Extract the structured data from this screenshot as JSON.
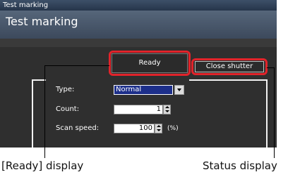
{
  "window": {
    "titlebar_text": "Test marking",
    "header_title": "Test marking"
  },
  "status": {
    "ready_label": "Ready",
    "status_label": "Close shutter"
  },
  "form": {
    "type_label": "Type:",
    "type_value": "Normal",
    "count_label": "Count:",
    "count_value": "1",
    "scan_speed_label": "Scan speed:",
    "scan_speed_value": "100",
    "scan_speed_unit": "(%)"
  },
  "captions": {
    "ready_caption": "[Ready] display",
    "status_caption": "Status display"
  },
  "colors": {
    "callout_red": "#e2232a",
    "select_blue": "#1d2f8a"
  }
}
